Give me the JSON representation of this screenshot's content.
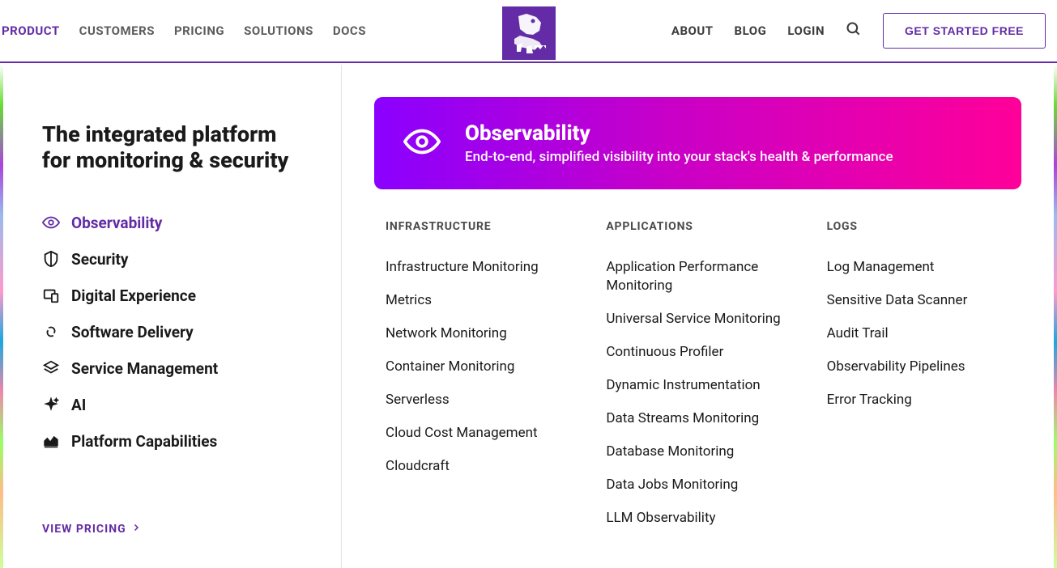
{
  "nav": {
    "left": [
      {
        "label": "PRODUCT",
        "active": true
      },
      {
        "label": "CUSTOMERS",
        "active": false
      },
      {
        "label": "PRICING",
        "active": false
      },
      {
        "label": "SOLUTIONS",
        "active": false
      },
      {
        "label": "DOCS",
        "active": false
      }
    ],
    "right": [
      {
        "label": "ABOUT"
      },
      {
        "label": "BLOG"
      },
      {
        "label": "LOGIN"
      }
    ],
    "cta": "GET STARTED FREE"
  },
  "sidebar": {
    "heading": "The integrated platform for monitoring & security",
    "items": [
      {
        "label": "Observability",
        "icon": "eye-icon",
        "active": true
      },
      {
        "label": "Security",
        "icon": "shield-icon",
        "active": false
      },
      {
        "label": "Digital Experience",
        "icon": "device-icon",
        "active": false
      },
      {
        "label": "Software Delivery",
        "icon": "link-icon",
        "active": false
      },
      {
        "label": "Service Management",
        "icon": "stack-icon",
        "active": false
      },
      {
        "label": "AI",
        "icon": "sparkle-icon",
        "active": false
      },
      {
        "label": "Platform Capabilities",
        "icon": "chart-icon",
        "active": false
      }
    ],
    "view_pricing": "VIEW PRICING"
  },
  "hero": {
    "title": "Observability",
    "subtitle": "End-to-end, simplified visibility into your stack's health & performance"
  },
  "columns": [
    {
      "header": "INFRASTRUCTURE",
      "links": [
        "Infrastructure Monitoring",
        "Metrics",
        "Network Monitoring",
        "Container Monitoring",
        "Serverless",
        "Cloud Cost Management",
        "Cloudcraft"
      ]
    },
    {
      "header": "APPLICATIONS",
      "links": [
        "Application Performance Monitoring",
        "Universal Service Monitoring",
        "Continuous Profiler",
        "Dynamic Instrumentation",
        "Data Streams Monitoring",
        "Database Monitoring",
        "Data Jobs Monitoring",
        "LLM Observability"
      ]
    },
    {
      "header": "LOGS",
      "links": [
        "Log Management",
        "Sensitive Data Scanner",
        "Audit Trail",
        "Observability Pipelines",
        "Error Tracking"
      ]
    }
  ]
}
